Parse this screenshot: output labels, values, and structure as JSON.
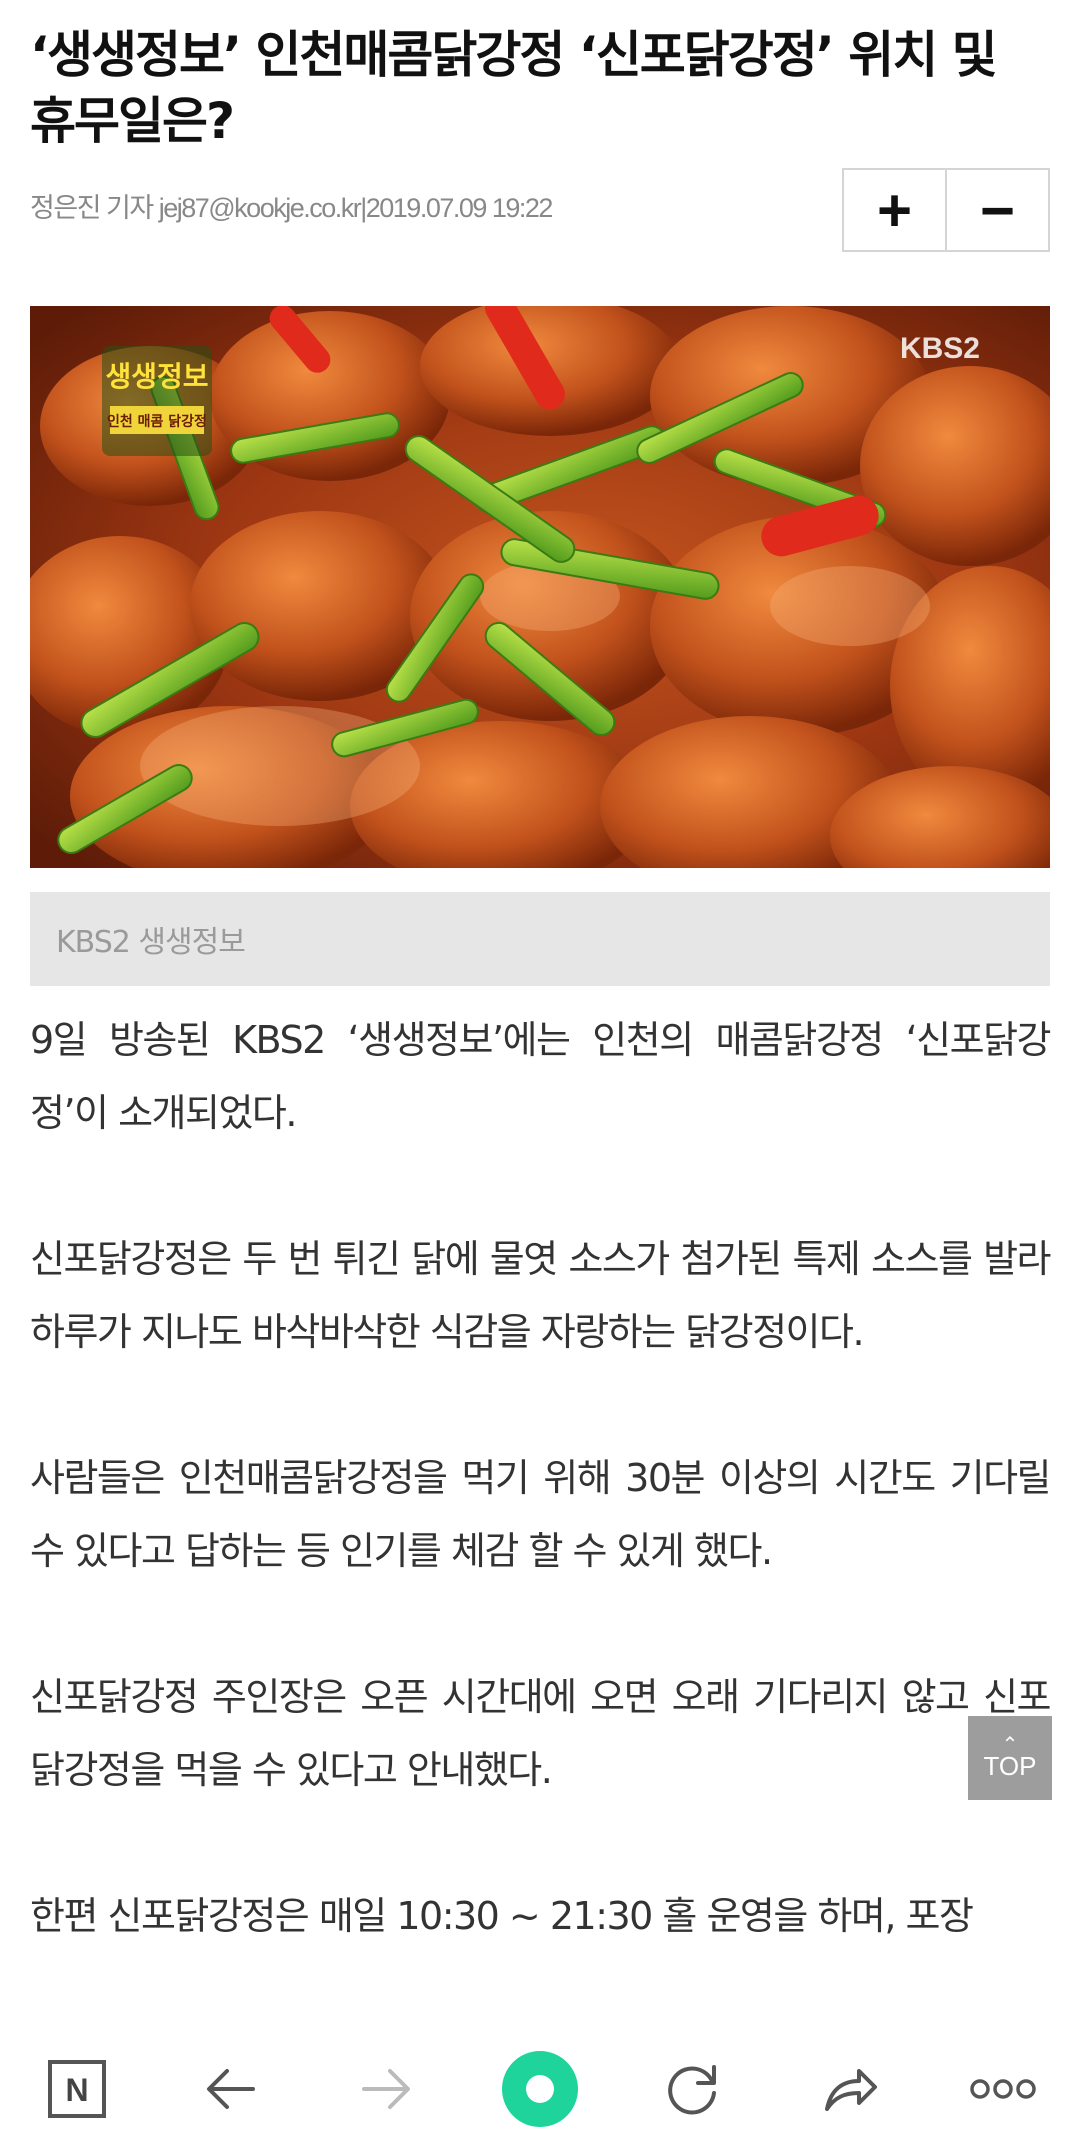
{
  "article": {
    "headline": "‘생생정보’ 인천매콤닭강정 ‘신포닭강정’ 위치 및 휴무일은?",
    "byline": {
      "author": "정은진 기자",
      "email": "jej87@kookje.co.kr",
      "separator": "|",
      "datetime": "2019.07.09 19:22"
    },
    "font_controls": {
      "increase_label": "+",
      "decrease_label": "−"
    },
    "photo": {
      "watermark": "KBS2",
      "show_logo": "생생정보",
      "show_sub": "인천 매콤 닭강정"
    },
    "caption": "KBS2 생생정보",
    "paragraphs": [
      "9일 방송된 KBS2 ‘생생정보’에는 인천의 매콤닭강정 ‘신포닭강정’이 소개되었다.",
      "신포닭강정은 두 번 튀긴 닭에 물엿 소스가 첨가된 특제 소스를 발라 하루가 지나도 바삭바삭한 식감을 자랑하는 닭강정이다.",
      "사람들은 인천매콤닭강정을 먹기 위해 30분 이상의 시간도 기다릴 수 있다고 답하는 등 인기를 체감 할 수 있게 했다.",
      "신포닭강정 주인장은 오픈 시간대에 오면 오래 기다리지 않고 신포닭강정을 먹을 수 있다고 안내했다.",
      "한편 신포닭강정은 매일 10:30 ~ 21:30 홀 운영을 하며, 포장"
    ]
  },
  "top_button": {
    "label": "TOP",
    "icon": "chevron-up-icon"
  },
  "bottom_nav": {
    "items": [
      {
        "name": "naver-home",
        "icon": "naver-n-icon",
        "label": "N"
      },
      {
        "name": "back",
        "icon": "arrow-left-icon"
      },
      {
        "name": "forward",
        "icon": "arrow-right-icon"
      },
      {
        "name": "green-dot",
        "icon": "green-dot-icon"
      },
      {
        "name": "refresh",
        "icon": "refresh-icon"
      },
      {
        "name": "share",
        "icon": "share-icon"
      },
      {
        "name": "more",
        "icon": "more-icon"
      }
    ],
    "accent_color": "#1ed49a"
  }
}
